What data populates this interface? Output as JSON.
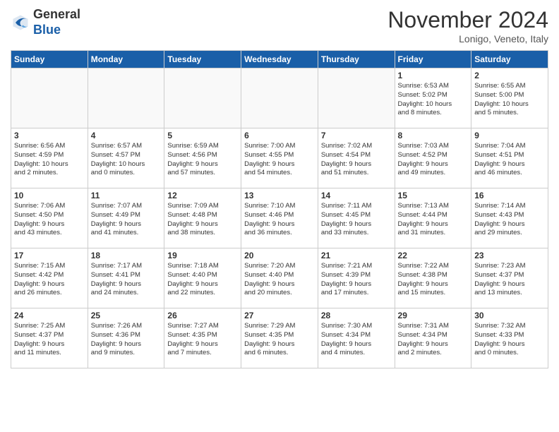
{
  "header": {
    "logo_general": "General",
    "logo_blue": "Blue",
    "title": "November 2024",
    "subtitle": "Lonigo, Veneto, Italy"
  },
  "days_of_week": [
    "Sunday",
    "Monday",
    "Tuesday",
    "Wednesday",
    "Thursday",
    "Friday",
    "Saturday"
  ],
  "weeks": [
    [
      {
        "day": "",
        "info": ""
      },
      {
        "day": "",
        "info": ""
      },
      {
        "day": "",
        "info": ""
      },
      {
        "day": "",
        "info": ""
      },
      {
        "day": "",
        "info": ""
      },
      {
        "day": "1",
        "info": "Sunrise: 6:53 AM\nSunset: 5:02 PM\nDaylight: 10 hours\nand 8 minutes."
      },
      {
        "day": "2",
        "info": "Sunrise: 6:55 AM\nSunset: 5:00 PM\nDaylight: 10 hours\nand 5 minutes."
      }
    ],
    [
      {
        "day": "3",
        "info": "Sunrise: 6:56 AM\nSunset: 4:59 PM\nDaylight: 10 hours\nand 2 minutes."
      },
      {
        "day": "4",
        "info": "Sunrise: 6:57 AM\nSunset: 4:57 PM\nDaylight: 10 hours\nand 0 minutes."
      },
      {
        "day": "5",
        "info": "Sunrise: 6:59 AM\nSunset: 4:56 PM\nDaylight: 9 hours\nand 57 minutes."
      },
      {
        "day": "6",
        "info": "Sunrise: 7:00 AM\nSunset: 4:55 PM\nDaylight: 9 hours\nand 54 minutes."
      },
      {
        "day": "7",
        "info": "Sunrise: 7:02 AM\nSunset: 4:54 PM\nDaylight: 9 hours\nand 51 minutes."
      },
      {
        "day": "8",
        "info": "Sunrise: 7:03 AM\nSunset: 4:52 PM\nDaylight: 9 hours\nand 49 minutes."
      },
      {
        "day": "9",
        "info": "Sunrise: 7:04 AM\nSunset: 4:51 PM\nDaylight: 9 hours\nand 46 minutes."
      }
    ],
    [
      {
        "day": "10",
        "info": "Sunrise: 7:06 AM\nSunset: 4:50 PM\nDaylight: 9 hours\nand 43 minutes."
      },
      {
        "day": "11",
        "info": "Sunrise: 7:07 AM\nSunset: 4:49 PM\nDaylight: 9 hours\nand 41 minutes."
      },
      {
        "day": "12",
        "info": "Sunrise: 7:09 AM\nSunset: 4:48 PM\nDaylight: 9 hours\nand 38 minutes."
      },
      {
        "day": "13",
        "info": "Sunrise: 7:10 AM\nSunset: 4:46 PM\nDaylight: 9 hours\nand 36 minutes."
      },
      {
        "day": "14",
        "info": "Sunrise: 7:11 AM\nSunset: 4:45 PM\nDaylight: 9 hours\nand 33 minutes."
      },
      {
        "day": "15",
        "info": "Sunrise: 7:13 AM\nSunset: 4:44 PM\nDaylight: 9 hours\nand 31 minutes."
      },
      {
        "day": "16",
        "info": "Sunrise: 7:14 AM\nSunset: 4:43 PM\nDaylight: 9 hours\nand 29 minutes."
      }
    ],
    [
      {
        "day": "17",
        "info": "Sunrise: 7:15 AM\nSunset: 4:42 PM\nDaylight: 9 hours\nand 26 minutes."
      },
      {
        "day": "18",
        "info": "Sunrise: 7:17 AM\nSunset: 4:41 PM\nDaylight: 9 hours\nand 24 minutes."
      },
      {
        "day": "19",
        "info": "Sunrise: 7:18 AM\nSunset: 4:40 PM\nDaylight: 9 hours\nand 22 minutes."
      },
      {
        "day": "20",
        "info": "Sunrise: 7:20 AM\nSunset: 4:40 PM\nDaylight: 9 hours\nand 20 minutes."
      },
      {
        "day": "21",
        "info": "Sunrise: 7:21 AM\nSunset: 4:39 PM\nDaylight: 9 hours\nand 17 minutes."
      },
      {
        "day": "22",
        "info": "Sunrise: 7:22 AM\nSunset: 4:38 PM\nDaylight: 9 hours\nand 15 minutes."
      },
      {
        "day": "23",
        "info": "Sunrise: 7:23 AM\nSunset: 4:37 PM\nDaylight: 9 hours\nand 13 minutes."
      }
    ],
    [
      {
        "day": "24",
        "info": "Sunrise: 7:25 AM\nSunset: 4:37 PM\nDaylight: 9 hours\nand 11 minutes."
      },
      {
        "day": "25",
        "info": "Sunrise: 7:26 AM\nSunset: 4:36 PM\nDaylight: 9 hours\nand 9 minutes."
      },
      {
        "day": "26",
        "info": "Sunrise: 7:27 AM\nSunset: 4:35 PM\nDaylight: 9 hours\nand 7 minutes."
      },
      {
        "day": "27",
        "info": "Sunrise: 7:29 AM\nSunset: 4:35 PM\nDaylight: 9 hours\nand 6 minutes."
      },
      {
        "day": "28",
        "info": "Sunrise: 7:30 AM\nSunset: 4:34 PM\nDaylight: 9 hours\nand 4 minutes."
      },
      {
        "day": "29",
        "info": "Sunrise: 7:31 AM\nSunset: 4:34 PM\nDaylight: 9 hours\nand 2 minutes."
      },
      {
        "day": "30",
        "info": "Sunrise: 7:32 AM\nSunset: 4:33 PM\nDaylight: 9 hours\nand 0 minutes."
      }
    ]
  ]
}
